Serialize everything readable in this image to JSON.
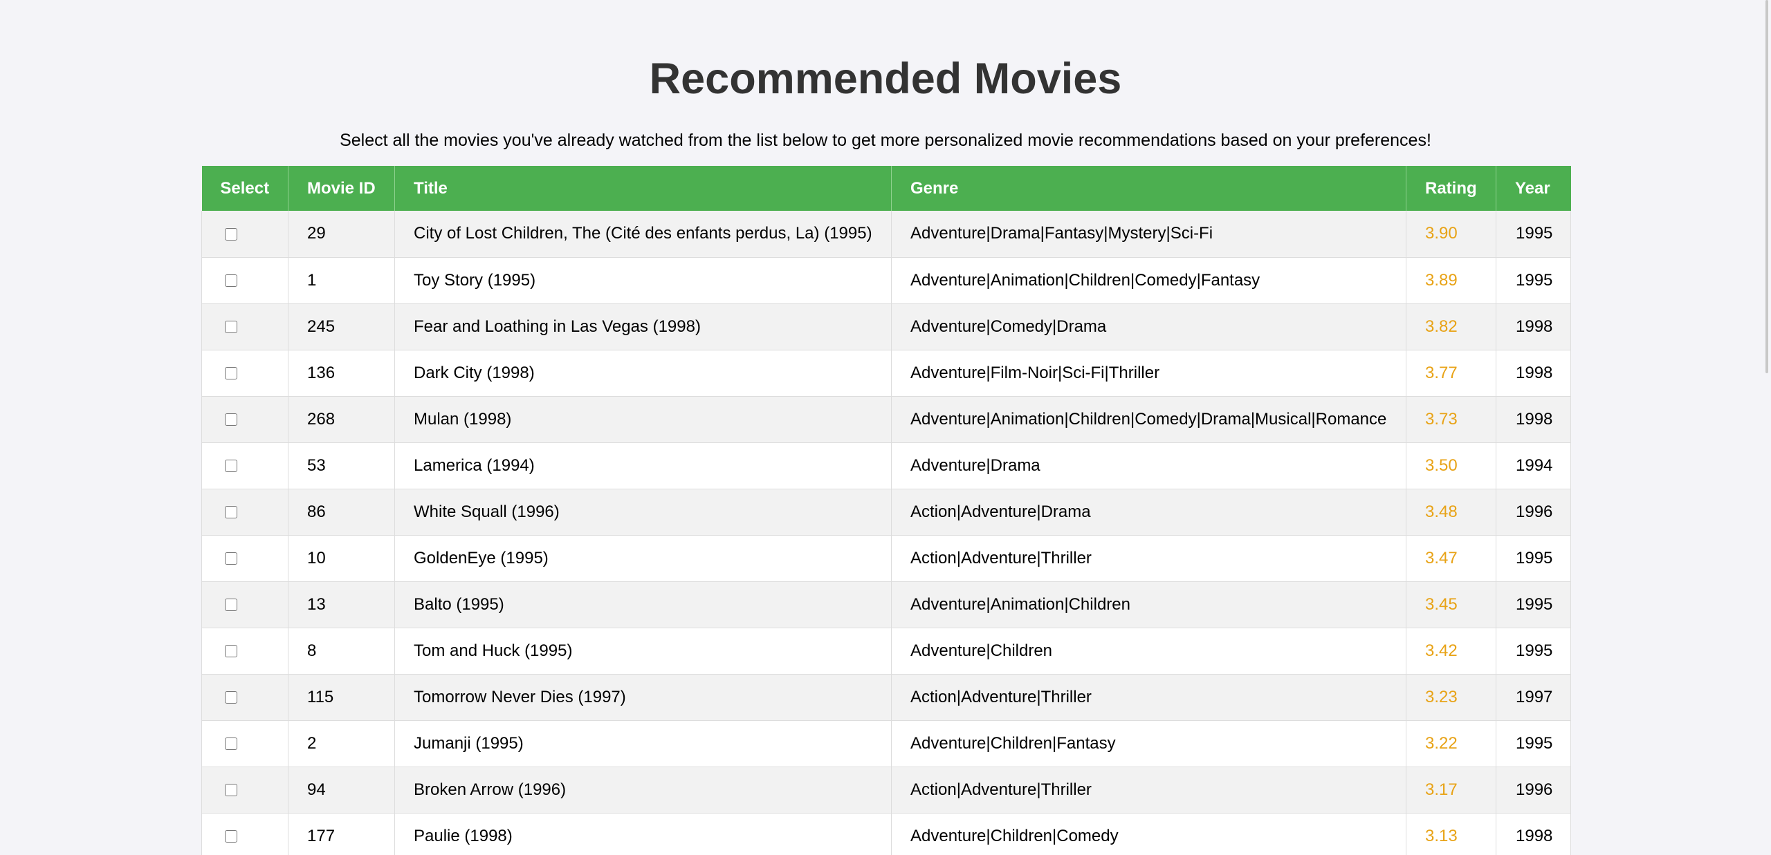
{
  "page": {
    "title": "Recommended Movies",
    "subtitle": "Select all the movies you've already watched from the list below to get more personalized movie recommendations based on your preferences!"
  },
  "table": {
    "headers": {
      "select": "Select",
      "movie_id": "Movie ID",
      "title": "Title",
      "genre": "Genre",
      "rating": "Rating",
      "year": "Year"
    },
    "rows": [
      {
        "id": "29",
        "title": "City of Lost Children, The (Cité des enfants perdus, La) (1995)",
        "genre": "Adventure|Drama|Fantasy|Mystery|Sci-Fi",
        "rating": "3.90",
        "year": "1995",
        "checked": false
      },
      {
        "id": "1",
        "title": "Toy Story (1995)",
        "genre": "Adventure|Animation|Children|Comedy|Fantasy",
        "rating": "3.89",
        "year": "1995",
        "checked": false
      },
      {
        "id": "245",
        "title": "Fear and Loathing in Las Vegas (1998)",
        "genre": "Adventure|Comedy|Drama",
        "rating": "3.82",
        "year": "1998",
        "checked": false
      },
      {
        "id": "136",
        "title": "Dark City (1998)",
        "genre": "Adventure|Film-Noir|Sci-Fi|Thriller",
        "rating": "3.77",
        "year": "1998",
        "checked": false
      },
      {
        "id": "268",
        "title": "Mulan (1998)",
        "genre": "Adventure|Animation|Children|Comedy|Drama|Musical|Romance",
        "rating": "3.73",
        "year": "1998",
        "checked": false
      },
      {
        "id": "53",
        "title": "Lamerica (1994)",
        "genre": "Adventure|Drama",
        "rating": "3.50",
        "year": "1994",
        "checked": false
      },
      {
        "id": "86",
        "title": "White Squall (1996)",
        "genre": "Action|Adventure|Drama",
        "rating": "3.48",
        "year": "1996",
        "checked": false
      },
      {
        "id": "10",
        "title": "GoldenEye (1995)",
        "genre": "Action|Adventure|Thriller",
        "rating": "3.47",
        "year": "1995",
        "checked": false
      },
      {
        "id": "13",
        "title": "Balto (1995)",
        "genre": "Adventure|Animation|Children",
        "rating": "3.45",
        "year": "1995",
        "checked": false
      },
      {
        "id": "8",
        "title": "Tom and Huck (1995)",
        "genre": "Adventure|Children",
        "rating": "3.42",
        "year": "1995",
        "checked": false
      },
      {
        "id": "115",
        "title": "Tomorrow Never Dies (1997)",
        "genre": "Action|Adventure|Thriller",
        "rating": "3.23",
        "year": "1997",
        "checked": false
      },
      {
        "id": "2",
        "title": "Jumanji (1995)",
        "genre": "Adventure|Children|Fantasy",
        "rating": "3.22",
        "year": "1995",
        "checked": false
      },
      {
        "id": "94",
        "title": "Broken Arrow (1996)",
        "genre": "Action|Adventure|Thriller",
        "rating": "3.17",
        "year": "1996",
        "checked": false
      },
      {
        "id": "177",
        "title": "Paulie (1998)",
        "genre": "Adventure|Children|Comedy",
        "rating": "3.13",
        "year": "1998",
        "checked": false
      }
    ]
  },
  "colors": {
    "header_bg": "#4caf50",
    "header_text": "#ffffff",
    "rating_text": "#e8a317",
    "title_text": "#333333",
    "page_bg": "#f4f4f8"
  }
}
